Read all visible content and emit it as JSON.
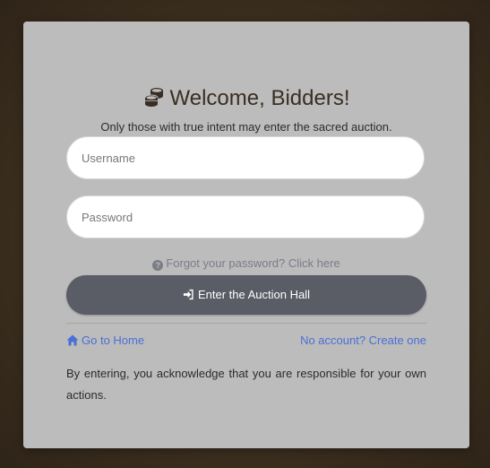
{
  "login": {
    "title": "Welcome, Bidders!",
    "subtitle": "Only those with true intent may enter the sacred auction.",
    "username_placeholder": "Username",
    "password_placeholder": "Password",
    "forgot_label": "Forgot your password? Click here",
    "enter_label": "Enter the Auction Hall",
    "home_label": "Go to Home",
    "create_label": "No account? Create one",
    "disclaimer": "By entering, you acknowledge that you are responsible for your own actions."
  },
  "icons": {
    "title": "coins-icon",
    "forgot": "question-circle-icon",
    "enter": "sign-in-icon",
    "home": "home-icon"
  },
  "colors": {
    "card_bg": "#bcbcbc",
    "button_bg": "#5a5c66",
    "link": "#4a6fd6",
    "title_text": "#3a2e22"
  }
}
